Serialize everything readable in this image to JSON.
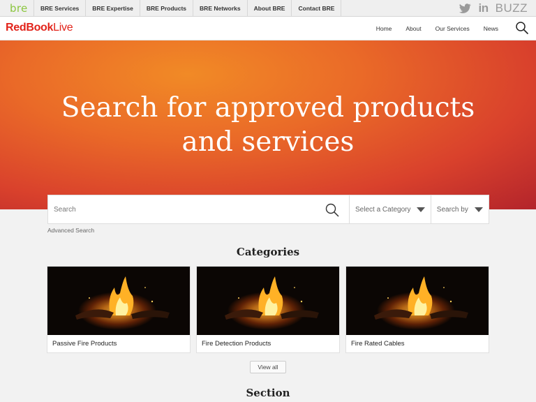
{
  "topbar": {
    "logo": "bre",
    "nav": [
      "BRE Services",
      "BRE Expertise",
      "BRE Products",
      "BRE Networks",
      "About BRE",
      "Contact BRE"
    ],
    "social": {
      "twitter_icon": "twitter-icon",
      "linkedin": "in",
      "buzz": "BUZZ"
    }
  },
  "header": {
    "brand_a": "RedBook",
    "brand_b": "Live",
    "nav": [
      "Home",
      "About",
      "Our Services",
      "News"
    ],
    "search_icon": "search-icon"
  },
  "hero": {
    "title_line1": "Search for approved products",
    "title_line2": "and services"
  },
  "search": {
    "placeholder": "Search",
    "category_label": "Select a Category",
    "searchby_label": "Search by",
    "advanced": "Advanced Search"
  },
  "categories": {
    "heading": "Categories",
    "cards": [
      {
        "label": "Passive Fire Products"
      },
      {
        "label": "Fire Detection Products"
      },
      {
        "label": "Fire Rated Cables"
      }
    ],
    "view_all": "View all"
  },
  "section": {
    "heading": "Section"
  },
  "colors": {
    "brand_red": "#e2231a",
    "bre_green": "#8cc63f",
    "hero_orange": "#ea6a28",
    "hero_red": "#b3242b"
  }
}
